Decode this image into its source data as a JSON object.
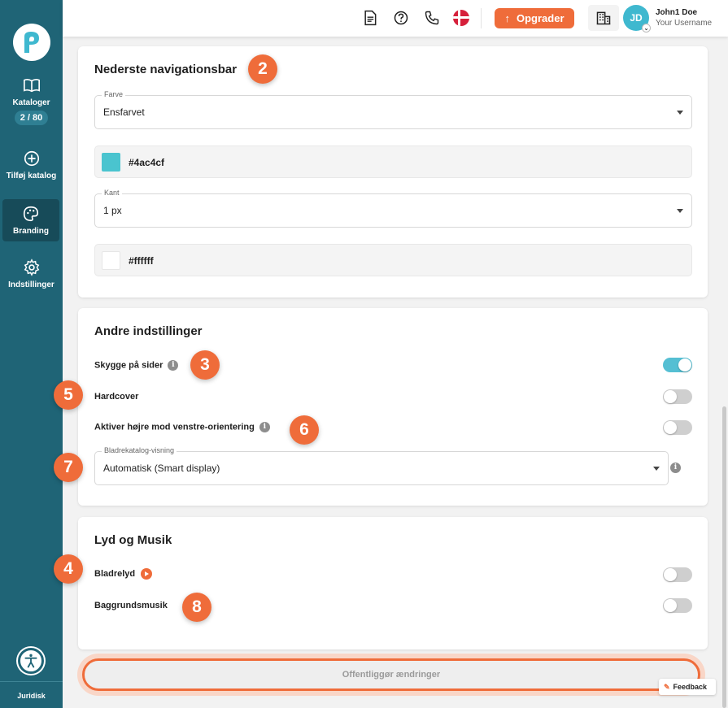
{
  "sidebar": {
    "items": [
      {
        "label": "Kataloger",
        "icon": "book-open-icon",
        "badge": "2 / 80"
      },
      {
        "label": "Tilføj katalog",
        "icon": "plus-circle-icon"
      },
      {
        "label": "Branding",
        "icon": "palette-icon",
        "active": true
      },
      {
        "label": "Indstillinger",
        "icon": "gear-icon"
      }
    ],
    "footer_label": "Juridisk"
  },
  "header": {
    "upgrade_label": "Opgrader",
    "user": {
      "initials": "JD",
      "name": "John1 Doe",
      "username": "Your Username"
    }
  },
  "nav_bar_section": {
    "title": "Nederste navigationsbar",
    "color_field": {
      "label": "Farve",
      "value": "Ensfarvet"
    },
    "color_value": "#4ac4cf",
    "border_field": {
      "label": "Kant",
      "value": "1 px"
    },
    "border_color": "#ffffff"
  },
  "other_settings": {
    "title": "Andre indstillinger",
    "shadow": {
      "label": "Skygge på sider",
      "enabled": true
    },
    "hardcover": {
      "label": "Hardcover",
      "enabled": false
    },
    "rtl": {
      "label": "Aktiver højre mod venstre-orientering",
      "enabled": false
    },
    "view_field": {
      "label": "Bladrekatalog-visning",
      "value": "Automatisk (Smart display)"
    }
  },
  "sound_section": {
    "title": "Lyd og Musik",
    "page_sound": {
      "label": "Bladrelyd",
      "enabled": false
    },
    "background_music": {
      "label": "Baggrundsmusik",
      "enabled": false
    }
  },
  "badges": [
    "2",
    "3",
    "5",
    "6",
    "7",
    "4",
    "8"
  ],
  "publish_label": "Offentliggør ændringer",
  "feedback_label": "Feedback",
  "colors": {
    "accent": "#ef6c3a",
    "sidebar": "#1f6476",
    "toggle_on": "#55bfd3"
  }
}
